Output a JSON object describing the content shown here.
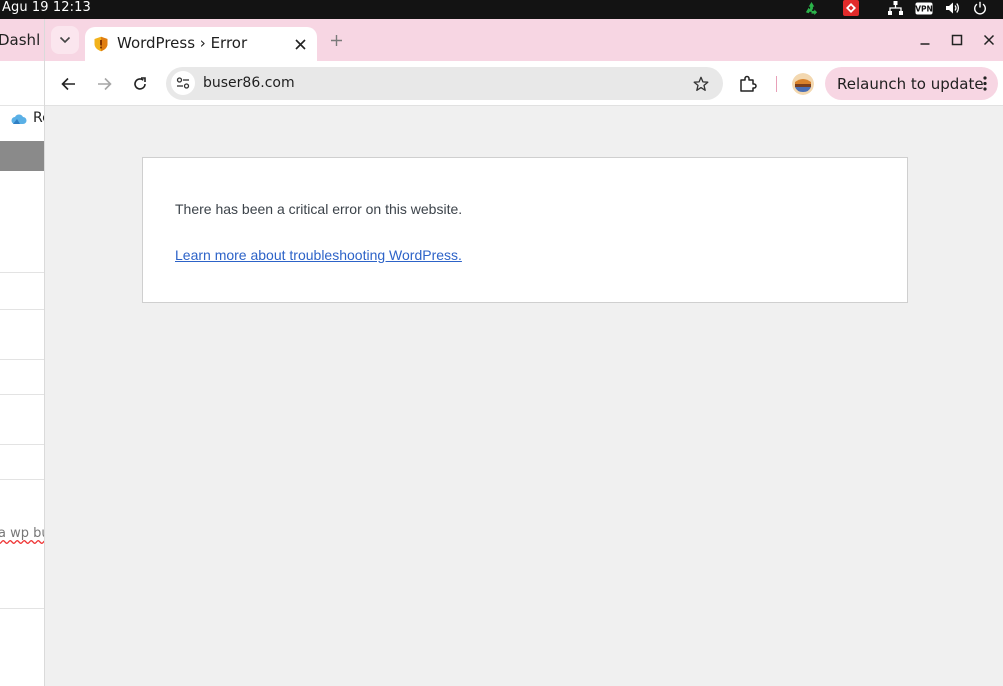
{
  "system": {
    "clock": "Agu 19  12:13",
    "tray_icons": [
      "recycle-icon",
      "anydesk-icon",
      "network-icon",
      "vpn-icon",
      "volume-icon",
      "power-icon"
    ],
    "vpn_label": "VPN"
  },
  "background_window": {
    "tab_label": "Dashl",
    "bookmark_label": "Re",
    "spell_text": "a wp bu"
  },
  "browser": {
    "tab": {
      "title": "WordPress › Error"
    },
    "address": {
      "url": "buser86.com"
    },
    "relaunch_label": "Relaunch to update"
  },
  "page": {
    "error_message": "There has been a critical error on this website.",
    "help_link": "Learn more about troubleshooting WordPress."
  },
  "colors": {
    "tab_strip": "#f7d6e3",
    "link": "#2d63c8",
    "page_bg": "#f0f0f0"
  }
}
